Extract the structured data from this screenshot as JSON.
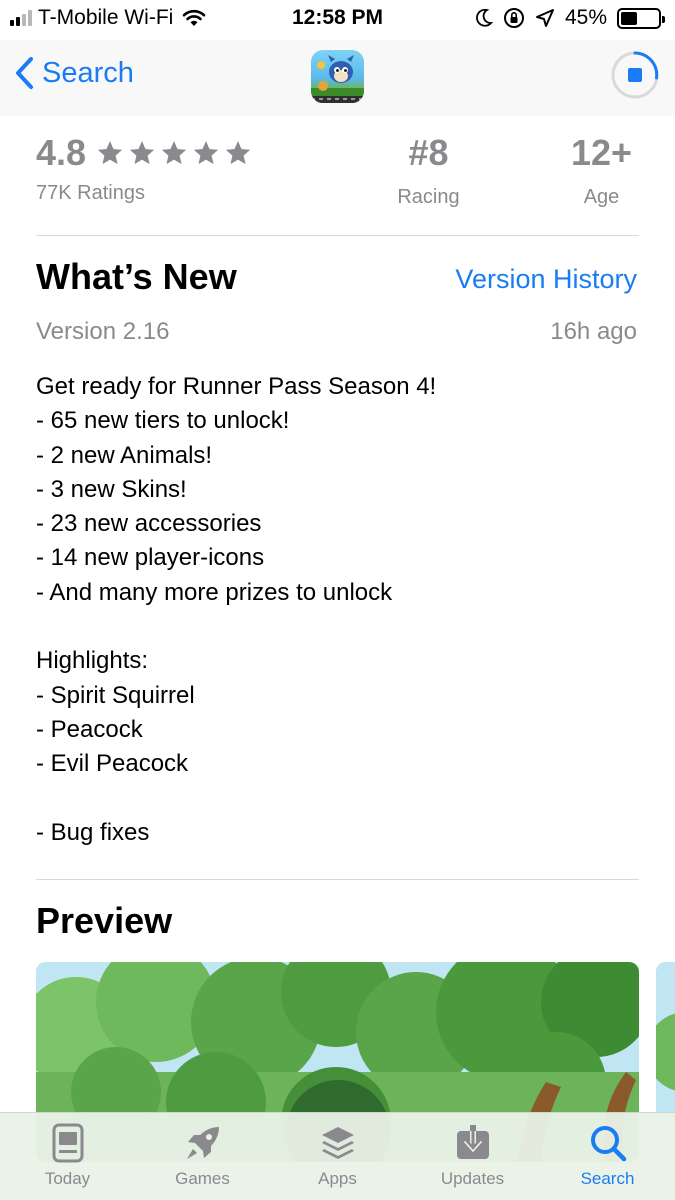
{
  "status_bar": {
    "carrier": "T-Mobile Wi-Fi",
    "time": "12:58 PM",
    "battery": "45%",
    "battery_level": 0.45
  },
  "nav": {
    "back_label": "Search",
    "app_icon": "runner-game-app-icon",
    "download_button": "stop-download-icon"
  },
  "ratings": {
    "score": "4.8",
    "stars": 5,
    "count": "77K Ratings",
    "rank": "#8",
    "rank_label": "Racing",
    "age": "12+",
    "age_label": "Age"
  },
  "whats_new": {
    "title": "What’s New",
    "version_history": "Version History",
    "version": "Version 2.16",
    "time_ago": "16h ago",
    "notes": [
      "Get ready for Runner Pass Season 4!",
      "- 65 new tiers to unlock!",
      "- 2 new Animals!",
      "- 3 new Skins!",
      "- 23 new accessories",
      "- 14 new player-icons",
      "- And many more prizes to unlock",
      "",
      "Highlights:",
      "- Spirit Squirrel",
      "- Peacock",
      "- Evil Peacock",
      "",
      "- Bug fixes"
    ]
  },
  "preview": {
    "title": "Preview"
  },
  "tabbar": {
    "tabs": [
      {
        "label": "Today",
        "icon": "today-icon"
      },
      {
        "label": "Games",
        "icon": "rocket-icon"
      },
      {
        "label": "Apps",
        "icon": "apps-stack-icon"
      },
      {
        "label": "Updates",
        "icon": "updates-download-icon"
      },
      {
        "label": "Search",
        "icon": "search-icon"
      }
    ],
    "active_tab": "Search"
  },
  "colors": {
    "accent": "#1a7cf5",
    "secondary_text": "#8a8a8e"
  }
}
